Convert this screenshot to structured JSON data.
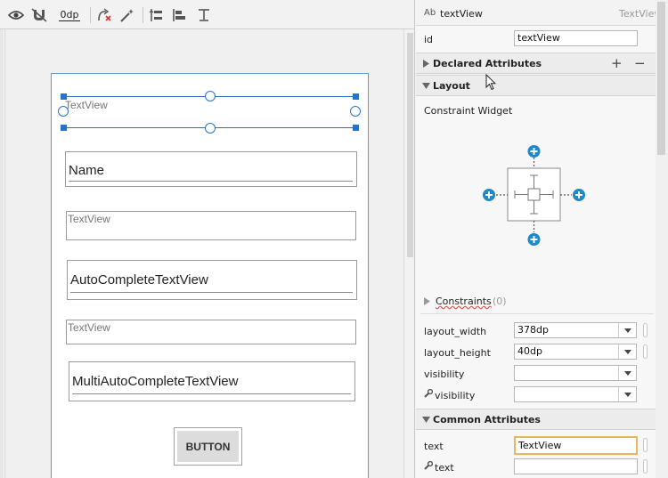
{
  "toolbar": {
    "icons": [
      "eye-icon",
      "magnet-off-icon",
      "margin-value",
      "clear-constraints-icon",
      "infer-constraints-icon",
      "pack-icon",
      "align-icon",
      "guidelines-icon"
    ],
    "default_margin": "0dp"
  },
  "layout": {
    "widgets": {
      "selected_textview": "TextView",
      "name_field": "Name",
      "textview_2": "TextView",
      "autocomplete": "AutoCompleteTextView",
      "textview_3": "TextView",
      "multi_autocomplete": "MultiAutoCompleteTextView",
      "button": "BUTTON"
    }
  },
  "panel": {
    "header": {
      "type_icon": "Ab",
      "component_name": "textView",
      "component_type": "TextView"
    },
    "id_label": "id",
    "id_value": "textView",
    "declared": {
      "title": "Declared Attributes",
      "add": "+",
      "remove": "−"
    },
    "layout_section": {
      "title": "Layout",
      "widget_title": "Constraint Widget"
    },
    "constraints": {
      "label": "Constraints",
      "count": "(0)"
    },
    "attrs": {
      "layout_width_label": "layout_width",
      "layout_width_value": "378dp",
      "layout_height_label": "layout_height",
      "layout_height_value": "40dp",
      "visibility_label": "visibility",
      "visibility_value": "",
      "tools_visibility_label": "visibility",
      "tools_visibility_value": ""
    },
    "common": {
      "title": "Common Attributes",
      "text_label": "text",
      "text_value": "TextView",
      "tools_text_label": "text",
      "tools_text_value": ""
    }
  },
  "colors": {
    "selection": "#2a72c8",
    "constraint_plus": "#1e88c8",
    "focus_border": "#e8b860"
  }
}
